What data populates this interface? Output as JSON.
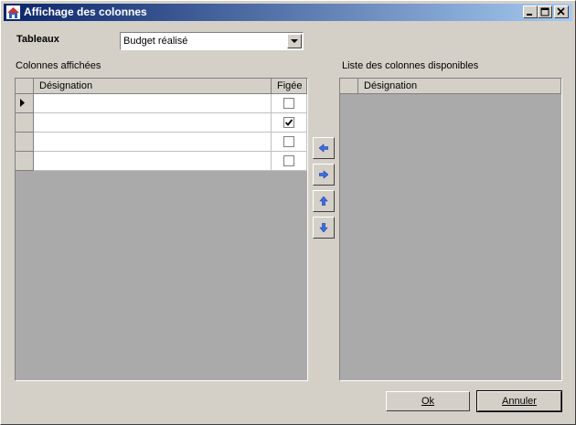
{
  "window": {
    "title": "Affichage des colonnes"
  },
  "tableaux": {
    "label": "Tableaux",
    "selected": "Budget réalisé"
  },
  "left_panel": {
    "label": "Colonnes affichées",
    "columns": [
      "Désignation",
      "Figée"
    ],
    "rows": [
      {
        "designation": "",
        "figee": false,
        "current": true
      },
      {
        "designation": "",
        "figee": true,
        "current": false
      },
      {
        "designation": "",
        "figee": false,
        "current": false
      },
      {
        "designation": "",
        "figee": false,
        "current": false
      }
    ]
  },
  "right_panel": {
    "label": "Liste des colonnes disponibles",
    "columns": [
      "Désignation"
    ]
  },
  "move_buttons": [
    "arrow-left-icon",
    "arrow-right-icon",
    "arrow-up-icon",
    "arrow-down-icon"
  ],
  "buttons": {
    "ok": "Ok",
    "cancel": "Annuler"
  },
  "colors": {
    "title_start": "#0a246a",
    "title_end": "#a6caf0",
    "face": "#d4d0c8",
    "grid_bg": "#aaaaaa",
    "arrow": "#3a6ee8"
  }
}
